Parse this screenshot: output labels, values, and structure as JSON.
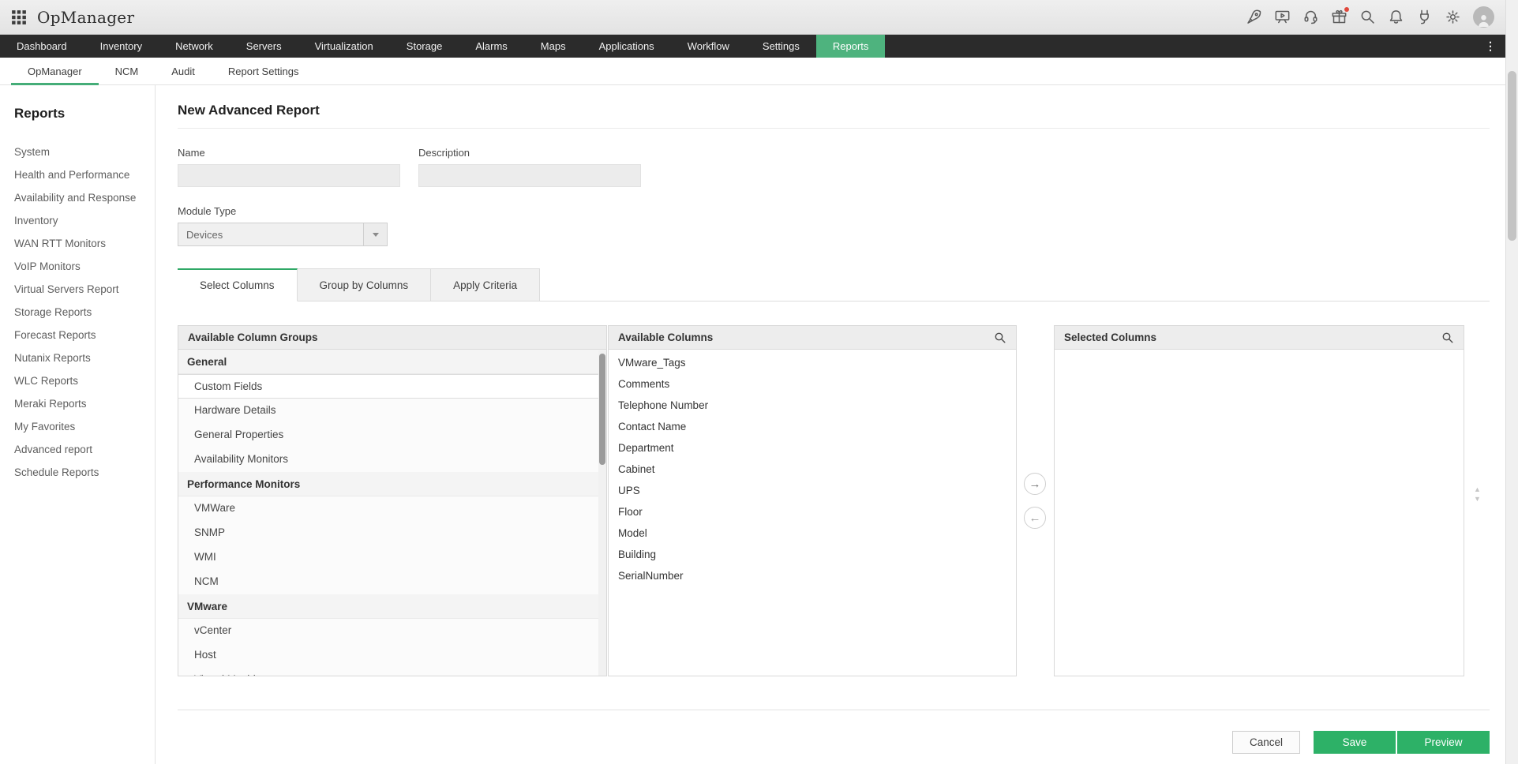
{
  "app": {
    "name": "OpManager"
  },
  "topbar": {
    "icon_names": [
      "launch-icon",
      "training-video-icon",
      "support-headset-icon",
      "whats-new-gift-icon",
      "search-icon",
      "notifications-bell-icon",
      "addons-plug-icon",
      "settings-gear-icon",
      "user-avatar"
    ]
  },
  "navbar": {
    "items": [
      {
        "label": "Dashboard"
      },
      {
        "label": "Inventory"
      },
      {
        "label": "Network"
      },
      {
        "label": "Servers"
      },
      {
        "label": "Virtualization"
      },
      {
        "label": "Storage"
      },
      {
        "label": "Alarms"
      },
      {
        "label": "Maps"
      },
      {
        "label": "Applications"
      },
      {
        "label": "Workflow"
      },
      {
        "label": "Settings"
      },
      {
        "label": "Reports",
        "active": true
      }
    ],
    "more": "⋮"
  },
  "subnav": {
    "items": [
      {
        "label": "OpManager",
        "active": true
      },
      {
        "label": "NCM"
      },
      {
        "label": "Audit"
      },
      {
        "label": "Report Settings"
      }
    ]
  },
  "sidebar": {
    "title": "Reports",
    "items": [
      {
        "label": "System"
      },
      {
        "label": "Health and Performance"
      },
      {
        "label": "Availability and Response"
      },
      {
        "label": "Inventory"
      },
      {
        "label": "WAN RTT Monitors"
      },
      {
        "label": "VoIP Monitors"
      },
      {
        "label": "Virtual Servers Report"
      },
      {
        "label": "Storage Reports"
      },
      {
        "label": "Forecast Reports"
      },
      {
        "label": "Nutanix Reports"
      },
      {
        "label": "WLC Reports"
      },
      {
        "label": "Meraki Reports"
      },
      {
        "label": "My Favorites"
      },
      {
        "label": "Advanced report"
      },
      {
        "label": "Schedule Reports"
      }
    ]
  },
  "report_form": {
    "title": "New Advanced Report",
    "name_label": "Name",
    "name_value": "",
    "description_label": "Description",
    "description_value": "",
    "module_type_label": "Module Type",
    "module_type_value": "Devices"
  },
  "tabs": {
    "items": [
      {
        "label": "Select Columns",
        "active": true
      },
      {
        "label": "Group by Columns"
      },
      {
        "label": "Apply Criteria"
      }
    ]
  },
  "column_groups_panel": {
    "header": "Available Column Groups",
    "sections": [
      {
        "title": "General",
        "items": [
          {
            "label": "Custom Fields",
            "selected": true
          },
          {
            "label": "Hardware Details"
          },
          {
            "label": "General Properties"
          },
          {
            "label": "Availability Monitors"
          }
        ]
      },
      {
        "title": "Performance Monitors",
        "items": [
          {
            "label": "VMWare"
          },
          {
            "label": "SNMP"
          },
          {
            "label": "WMI"
          },
          {
            "label": "NCM"
          }
        ]
      },
      {
        "title": "VMware",
        "items": [
          {
            "label": "vCenter"
          },
          {
            "label": "Host"
          },
          {
            "label": "Virtual Machine"
          }
        ]
      }
    ]
  },
  "available_columns_panel": {
    "header": "Available Columns",
    "items": [
      "VMware_Tags",
      "Comments",
      "Telephone Number",
      "Contact Name",
      "Department",
      "Cabinet",
      "UPS",
      "Floor",
      "Model",
      "Building",
      "SerialNumber"
    ]
  },
  "selected_columns_panel": {
    "header": "Selected Columns",
    "items": []
  },
  "transfer": {
    "right": "→",
    "left": "←",
    "up": "▲",
    "down": "▼"
  },
  "footer": {
    "cancel": "Cancel",
    "save": "Save",
    "preview": "Preview"
  },
  "colors": {
    "accent_green": "#4eb37e",
    "button_green": "#2db167",
    "nav_bg": "#2b2b2b"
  }
}
